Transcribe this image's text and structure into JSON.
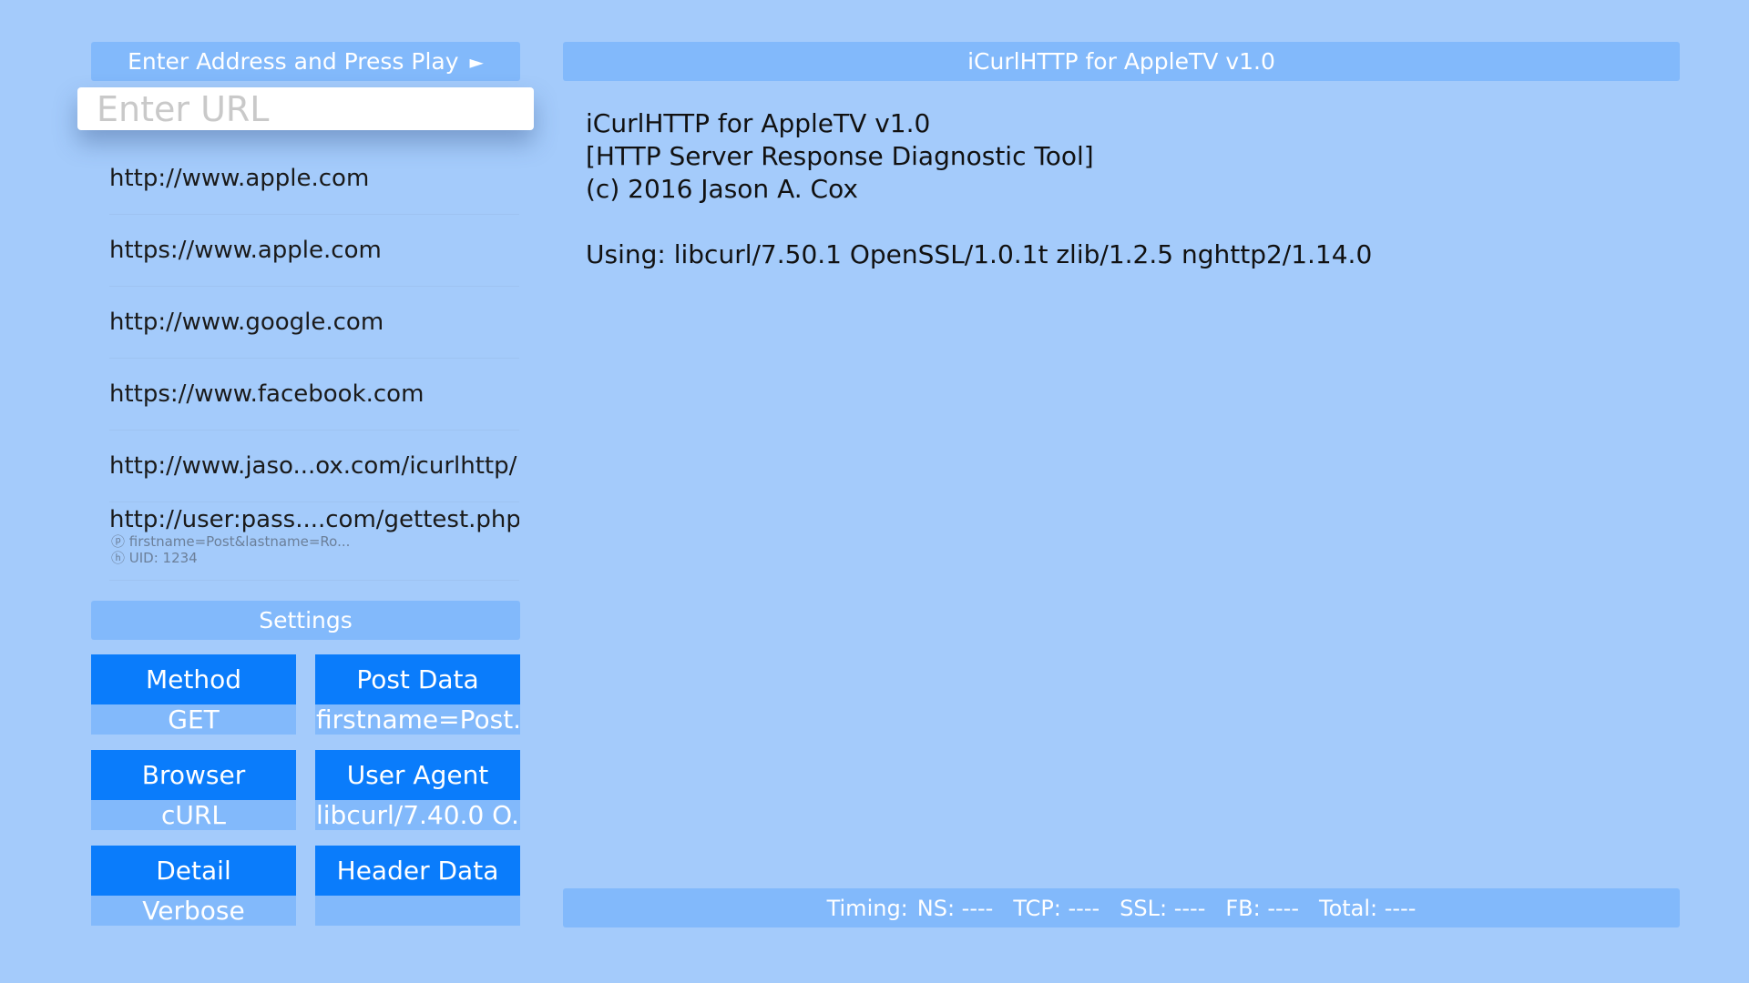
{
  "left_panel": {
    "header": "Enter Address and Press Play",
    "play_glyph": "►",
    "url_placeholder": "Enter URL",
    "history": [
      {
        "url": "http://www.apple.com"
      },
      {
        "url": "https://www.apple.com"
      },
      {
        "url": "http://www.google.com"
      },
      {
        "url": "https://www.facebook.com"
      },
      {
        "url": "http://www.jaso...ox.com/icurlhttp/"
      },
      {
        "url": "http://user:pass....com/gettest.php",
        "post": "ⓟ firstname=Post&lastname=Ro...",
        "header": "ⓗ UID: 1234"
      }
    ]
  },
  "settings": {
    "header": "Settings",
    "method": {
      "label": "Method",
      "value": "GET"
    },
    "post_data": {
      "label": "Post Data",
      "value": "firstname=Post..."
    },
    "browser": {
      "label": "Browser",
      "value": "cURL"
    },
    "user_agent": {
      "label": "User Agent",
      "value": "libcurl/7.40.0 O..."
    },
    "detail": {
      "label": "Detail",
      "value": "Verbose"
    },
    "header_data": {
      "label": "Header Data",
      "value": ""
    }
  },
  "main": {
    "title": "iCurlHTTP for AppleTV v1.0",
    "output_lines": [
      "iCurlHTTP for AppleTV v1.0",
      "[HTTP Server Response Diagnostic Tool]",
      "(c) 2016 Jason A. Cox",
      "Using: libcurl/7.50.1 OpenSSL/1.0.1t zlib/1.2.5 nghttp2/1.14.0"
    ]
  },
  "timing": {
    "label": "Timing:",
    "ns": "NS: ----",
    "tcp": "TCP: ----",
    "ssl": "SSL: ----",
    "fb": "FB: ----",
    "total": "Total: ----"
  },
  "colors": {
    "background": "#a4cbfb",
    "bar": "#82b9fb",
    "button": "#0a7cfb"
  }
}
